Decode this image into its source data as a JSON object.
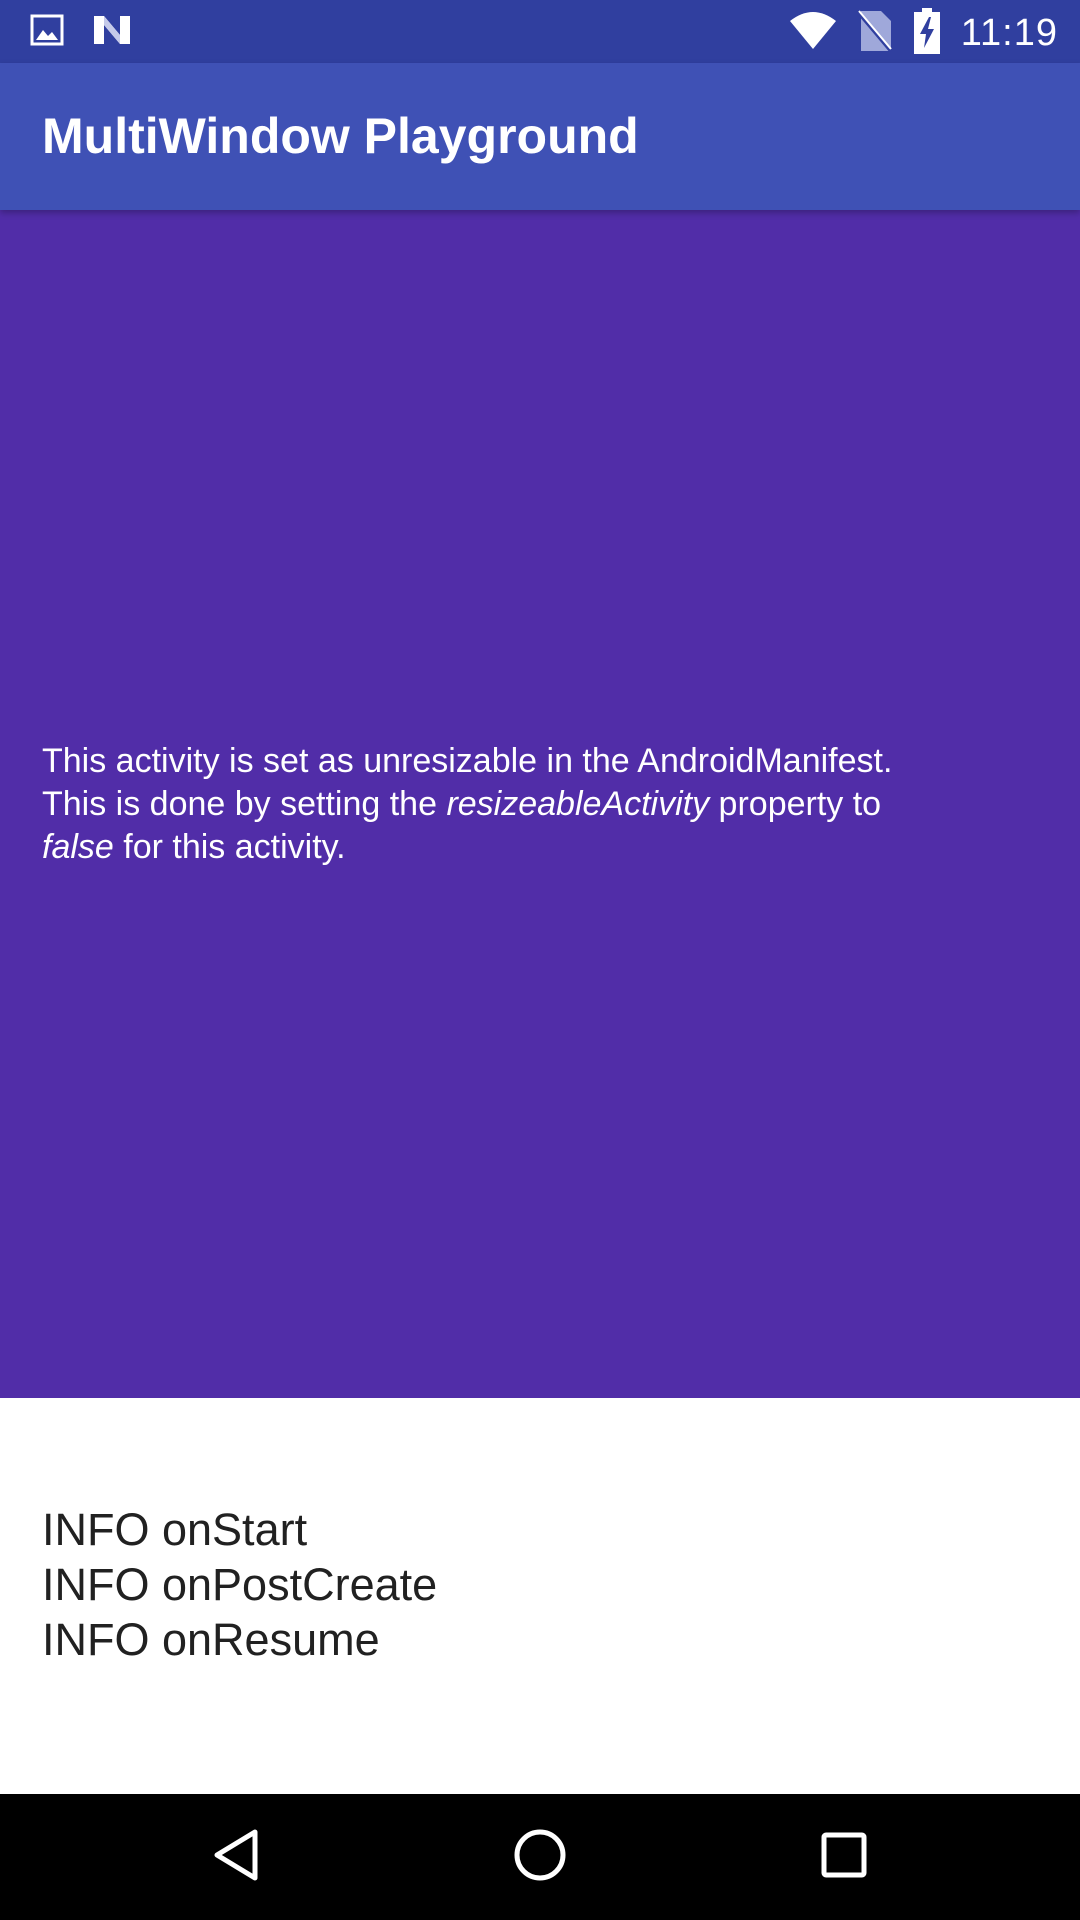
{
  "status_bar": {
    "time": "11:19",
    "icons": [
      "image-icon",
      "n-logo-icon",
      "wifi-icon",
      "no-sim-icon",
      "battery-charging-icon"
    ]
  },
  "app_bar": {
    "title": "MultiWindow Playground"
  },
  "content": {
    "line1": "This activity is set as unresizable in the AndroidManifest.",
    "line2_prefix": "This is done by setting the ",
    "line2_em": "resizeableActivity",
    "line2_suffix": " property to",
    "line3_em": "false",
    "line3_suffix": " for this activity.",
    "background_color": "#512da8"
  },
  "log": {
    "lines": [
      "INFO onStart",
      "INFO onPostCreate",
      "INFO onResume"
    ]
  },
  "nav_bar": {
    "buttons": [
      "back-icon",
      "home-icon",
      "recents-icon"
    ]
  },
  "colors": {
    "status_bar": "#303f9f",
    "app_bar": "#3f51b5",
    "content": "#512da8"
  }
}
